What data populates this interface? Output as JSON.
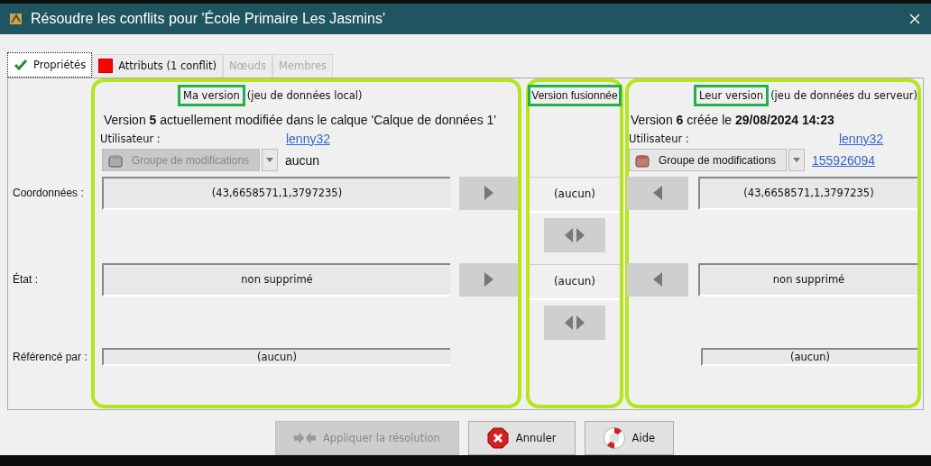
{
  "window": {
    "title": "Résoudre les conflits pour 'École Primaire Les Jasmins'"
  },
  "tabs": [
    {
      "label": "Propriétés",
      "selected": true,
      "disabled": false,
      "kind": "check"
    },
    {
      "label": "Attributs (1 conflit)",
      "selected": false,
      "disabled": false,
      "kind": "conflict"
    },
    {
      "label": "Nœuds",
      "selected": false,
      "disabled": true,
      "kind": "plain"
    },
    {
      "label": "Membres",
      "selected": false,
      "disabled": true,
      "kind": "plain"
    }
  ],
  "mine": {
    "heading": "Ma version",
    "heading_note": "(jeu de données local)",
    "version": "Version **5** actuellement modifiée dans le calque 'Calque de données 1'",
    "user_label": "Utilisateur :",
    "user": "lenny32",
    "changeset": {
      "label": "Groupe de modifications",
      "disabled": true
    },
    "changeset_value": "aucun",
    "changeset_is_link": false
  },
  "merged": {
    "heading": "Version fusionnée"
  },
  "theirs": {
    "heading": "Leur version",
    "heading_note": "(jeu de données du serveur)",
    "version": "Version **6** créée le **29/08/2024 14:23**",
    "user_label": "Utilisateur :",
    "user": "lenny32",
    "changeset": {
      "label": "Groupe de modifications",
      "disabled": false
    },
    "changeset_value": "155926094",
    "changeset_is_link": true
  },
  "rows": [
    {
      "kind": "conflict",
      "label": "Coordonnées :",
      "mine": "(43,6658571,1,3797235)",
      "merged": "(aucun)",
      "theirs": "(43,6658571,1,3797235)"
    },
    {
      "kind": "conflict",
      "label": "État :",
      "mine": "non supprimé",
      "merged": "(aucun)",
      "theirs": "non supprimé"
    },
    {
      "kind": "info",
      "label": "Référencé par :",
      "mine": "(aucun)",
      "theirs": "(aucun)"
    }
  ],
  "buttons": [
    {
      "label": "Appliquer la résolution",
      "kind": "apply",
      "disabled": true
    },
    {
      "label": "Annuler",
      "kind": "cancel",
      "disabled": false
    },
    {
      "label": "Aide",
      "kind": "help",
      "disabled": false
    }
  ]
}
